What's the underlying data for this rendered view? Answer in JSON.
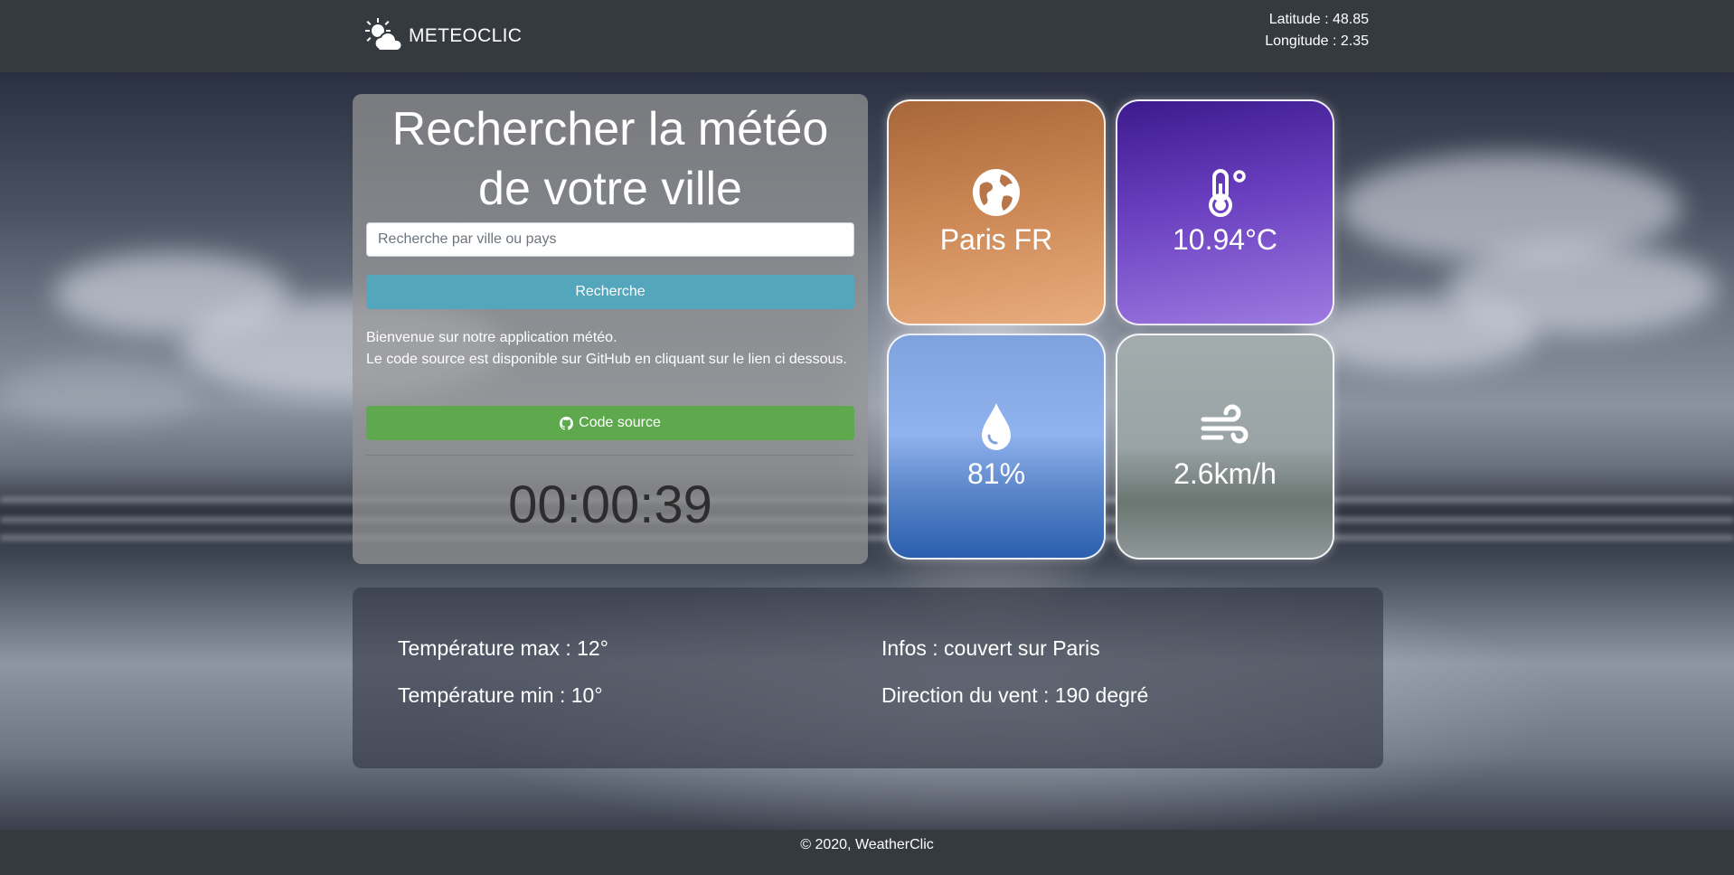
{
  "navbar": {
    "brand_icon": "sun-cloud-icon",
    "brand_name": "METEOCLIC",
    "latitude": "Latitude : 48.85",
    "longitude": "Longitude : 2.35"
  },
  "search": {
    "title_line1": "Rechercher la météo",
    "title_line2": "de votre ville",
    "placeholder": "Recherche par ville ou pays",
    "button_label": "Recherche",
    "welcome_line1": "Bienvenue sur notre application météo.",
    "welcome_line2": "Le code source est disponible sur GitHub en cliquant sur le lien ci dessous.",
    "source_icon": "github-icon",
    "source_label": "Code source",
    "clock": "00:00:39"
  },
  "tiles": {
    "city": {
      "icon": "globe-icon",
      "value": "Paris FR"
    },
    "temperature": {
      "icon": "thermometer-icon",
      "value": "10.94°C"
    },
    "humidity": {
      "icon": "droplet-icon",
      "value": "81%"
    },
    "wind": {
      "icon": "wind-icon",
      "value": "2.6km/h"
    }
  },
  "details": {
    "temp_max": "Température max : 12°",
    "temp_min": "Température min : 10°",
    "infos": "Infos : couvert sur Paris",
    "wind_direction": "Direction du vent : 190 degré"
  },
  "footer": {
    "copyright": "© 2020, WeatherClic"
  },
  "colors": {
    "navbar": "#343a40",
    "search_button": "#54a6bd",
    "source_button": "#5ea94d"
  }
}
